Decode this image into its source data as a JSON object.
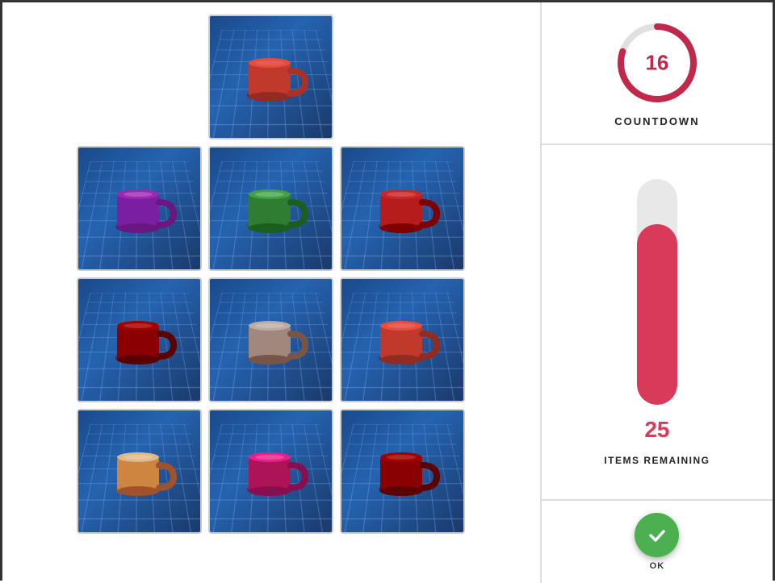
{
  "countdown": {
    "value": 16,
    "label": "COUNTDOWN",
    "circle_total": 20,
    "circle_used": 16
  },
  "progress": {
    "items_remaining": 25,
    "items_label": "ITEMS REMAINING",
    "bar_percent": 80
  },
  "ok_button": {
    "label": "OK"
  },
  "mugs": [
    {
      "id": "top-center",
      "color": "red",
      "row": 0
    },
    {
      "id": "r1c1",
      "color": "purple",
      "row": 1
    },
    {
      "id": "r1c2",
      "color": "green",
      "row": 1
    },
    {
      "id": "r1c3",
      "color": "red-dark",
      "row": 1
    },
    {
      "id": "r2c1",
      "color": "dark-red",
      "row": 2
    },
    {
      "id": "r2c2",
      "color": "tan",
      "row": 2
    },
    {
      "id": "r2c3",
      "color": "red-dark2",
      "row": 2
    },
    {
      "id": "r3c1",
      "color": "light-brown",
      "row": 3
    },
    {
      "id": "r3c2",
      "color": "magenta",
      "row": 3
    },
    {
      "id": "r3c3",
      "color": "dark-red2",
      "row": 3
    }
  ]
}
